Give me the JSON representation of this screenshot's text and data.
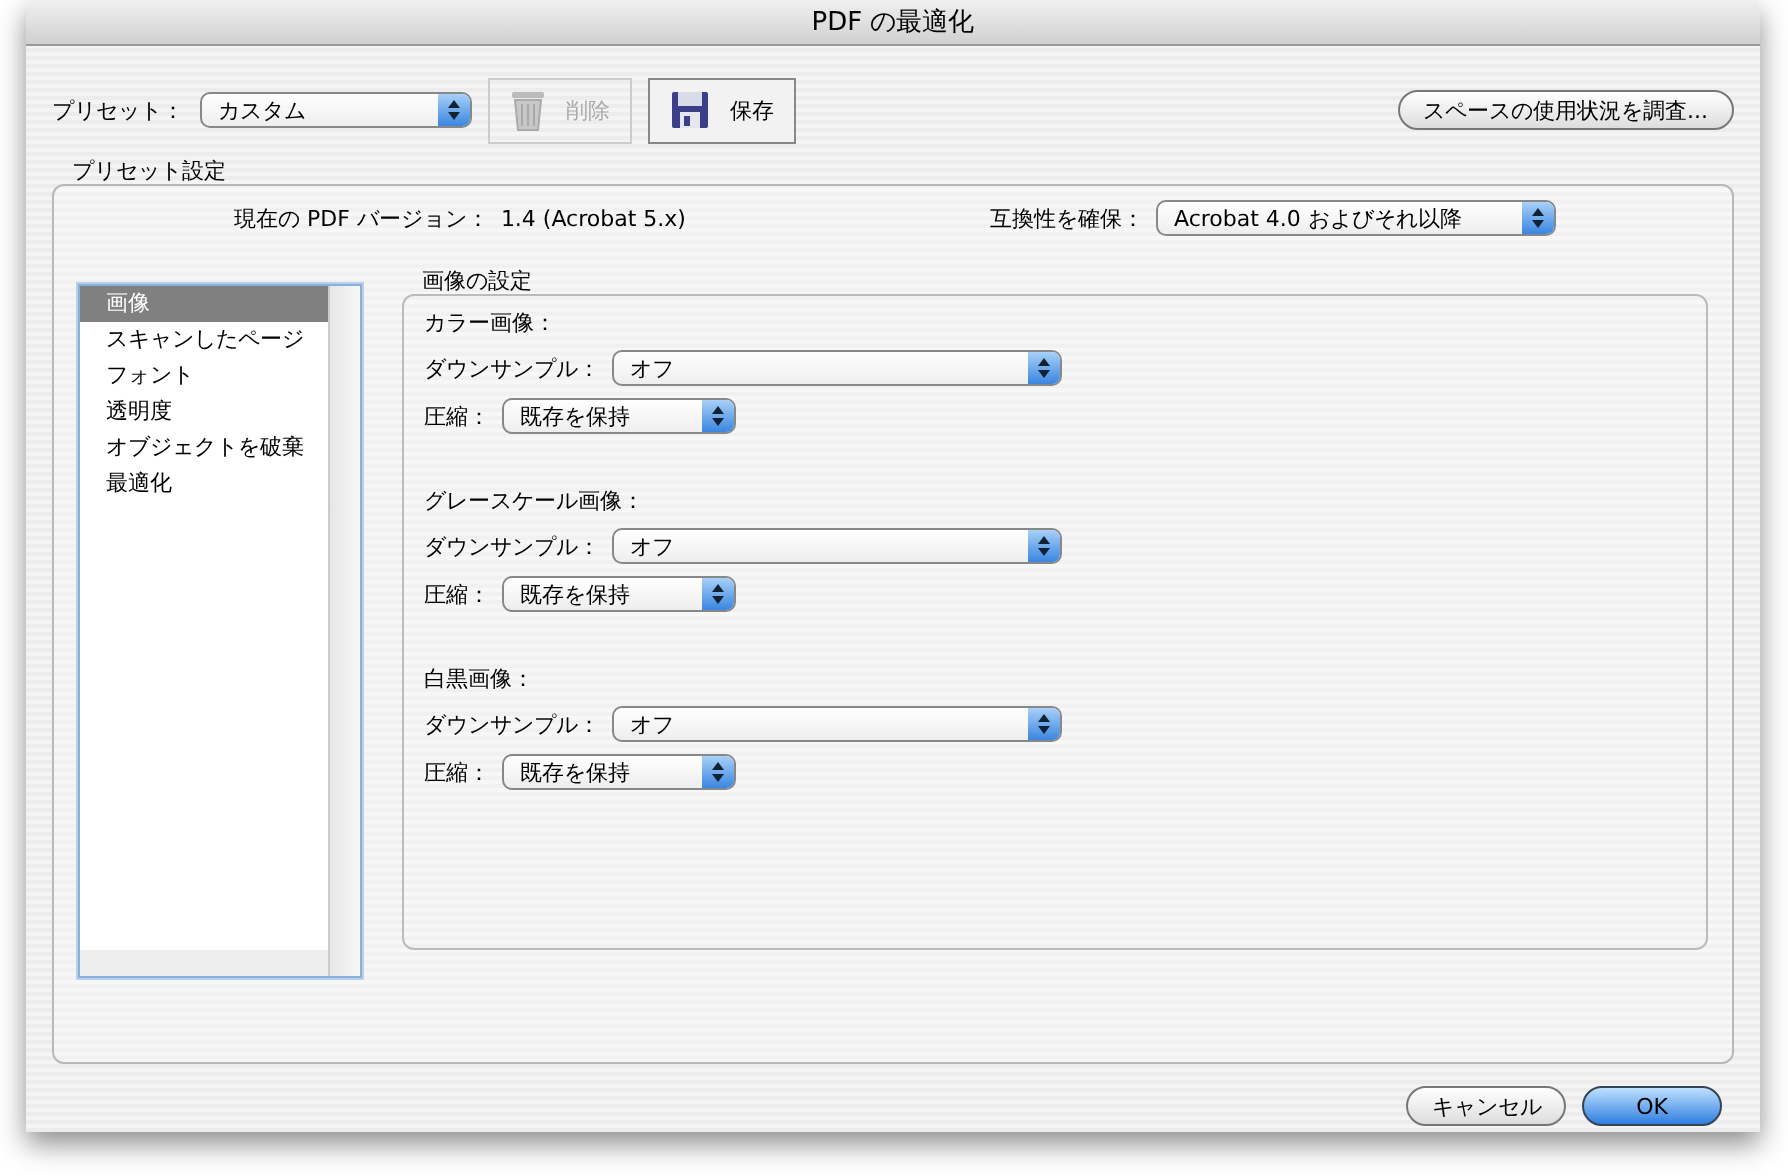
{
  "window": {
    "title": "PDF の最適化"
  },
  "toolbar": {
    "preset_label": "プリセット：",
    "preset_value": "カスタム",
    "buttons": [
      {
        "label": "削除",
        "kind": "delete",
        "disabled": true
      },
      {
        "label": "保存",
        "kind": "save",
        "disabled": false
      }
    ],
    "audit_button": "スペースの使用状況を調査..."
  },
  "preset_settings": {
    "title": "プリセット設定",
    "version_label": "現在の PDF バージョン：",
    "version_value": "1.4 (Acrobat 5.x)",
    "compat_label": "互換性を確保：",
    "compat_value": "Acrobat 4.0 およびそれ以降"
  },
  "sidebar": {
    "items": [
      {
        "label": "画像",
        "selected": true
      },
      {
        "label": "スキャンしたページ",
        "selected": false
      },
      {
        "label": "フォント",
        "selected": false
      },
      {
        "label": "透明度",
        "selected": false
      },
      {
        "label": "オブジェクトを破棄",
        "selected": false
      },
      {
        "label": "最適化",
        "selected": false
      }
    ]
  },
  "image_settings": {
    "title": "画像の設定",
    "groups": [
      {
        "title": "カラー画像：",
        "downsample_label": "ダウンサンプル：",
        "downsample_value": "オフ",
        "compression_label": "圧縮：",
        "compression_value": "既存を保持"
      },
      {
        "title": "グレースケール画像：",
        "downsample_label": "ダウンサンプル：",
        "downsample_value": "オフ",
        "compression_label": "圧縮：",
        "compression_value": "既存を保持"
      },
      {
        "title": "白黒画像：",
        "downsample_label": "ダウンサンプル：",
        "downsample_value": "オフ",
        "compression_label": "圧縮：",
        "compression_value": "既存を保持"
      }
    ]
  },
  "footer": {
    "cancel": "キャンセル",
    "ok": "OK"
  }
}
